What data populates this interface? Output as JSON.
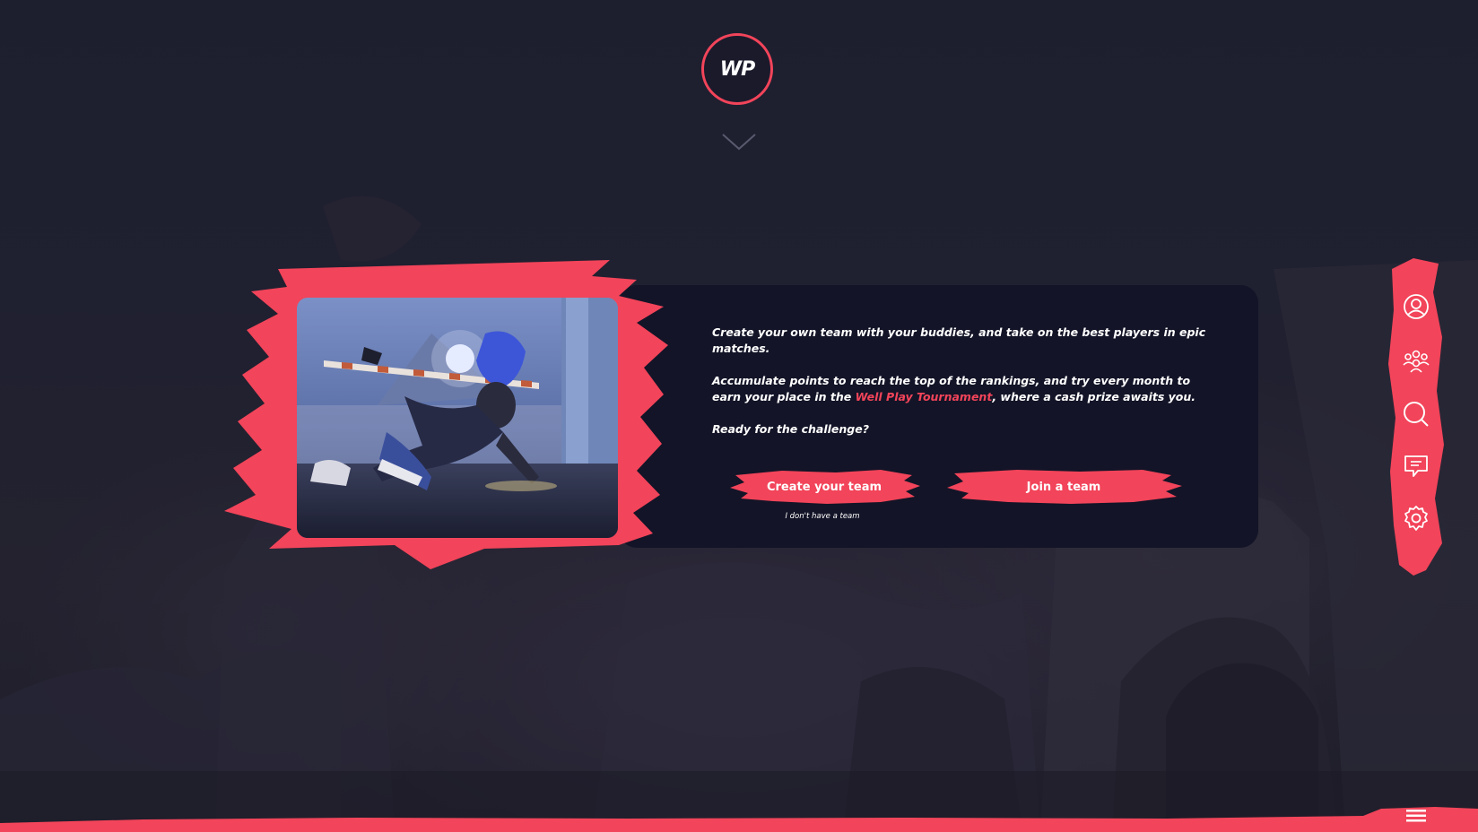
{
  "brand": {
    "logo_text": "WP",
    "accent_color": "#f2445a",
    "background_color": "#1f2030",
    "card_color": "#131427"
  },
  "intro": {
    "paragraph_1": "Create your own team with your buddies, and take on the best players in epic matches.",
    "paragraph_2_before": "Accumulate points to reach the top of the rankings, and try every month to earn your place in the ",
    "paragraph_2_link": "Well Play Tournament",
    "paragraph_2_after": ", where a cash prize awaits you.",
    "paragraph_3": "Ready for the challenge?"
  },
  "actions": {
    "create_label": "Create your team",
    "create_note": "I don't have  a team",
    "join_label": "Join a team"
  },
  "rail": {
    "icons": [
      "profile-icon",
      "team-icon",
      "search-icon",
      "chat-icon",
      "settings-icon"
    ]
  },
  "footer": {
    "menu_icon": "hamburger-icon"
  }
}
